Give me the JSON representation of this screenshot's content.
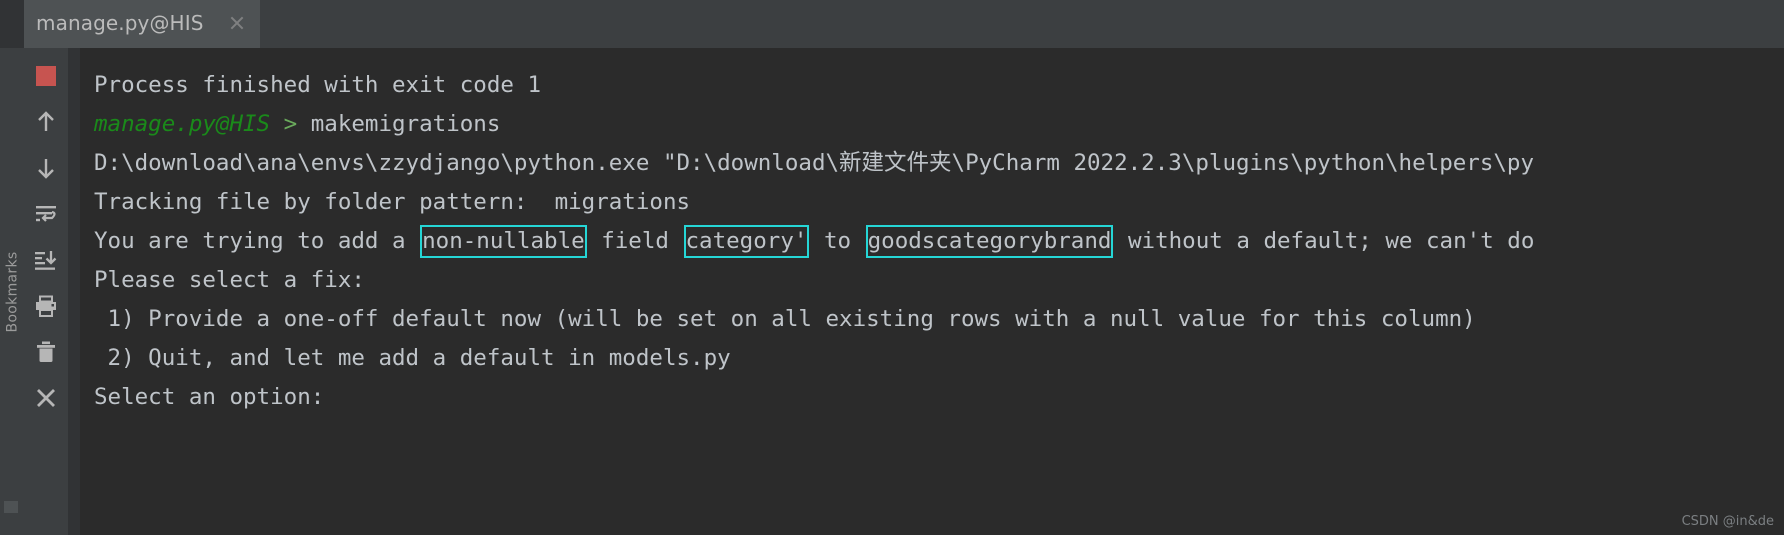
{
  "window": {
    "background_color": "#2b2b2b",
    "chrome_color": "#3c3f41"
  },
  "tab_bar": {
    "tabs": [
      {
        "label": "manage.py@HIS",
        "active": true,
        "close_icon": "close-icon"
      }
    ]
  },
  "left_strip": {
    "label": "Bookmarks"
  },
  "run_toolbar": {
    "buttons": [
      {
        "name": "stop-button",
        "icon": "stop-square-icon",
        "tooltip": "Stop",
        "color": "#c75450"
      },
      {
        "name": "up-button",
        "icon": "arrow-up-icon",
        "tooltip": "Previous Occurrence"
      },
      {
        "name": "down-button",
        "icon": "arrow-down-icon",
        "tooltip": "Next Occurrence"
      },
      {
        "name": "soft-wrap-button",
        "icon": "soft-wrap-icon",
        "tooltip": "Soft-Wrap"
      },
      {
        "name": "scroll-to-end-button",
        "icon": "scroll-to-end-icon",
        "tooltip": "Scroll to End"
      },
      {
        "name": "print-button",
        "icon": "printer-icon",
        "tooltip": "Print"
      },
      {
        "name": "clear-all-button",
        "icon": "trash-icon",
        "tooltip": "Clear All"
      },
      {
        "name": "close-button",
        "icon": "close-icon",
        "tooltip": "Close"
      }
    ]
  },
  "console": {
    "accent_box_color": "#25d6d6",
    "lines": [
      {
        "id": "process-finished",
        "segments": [
          {
            "text": "Process finished with exit code 1",
            "style": "plain"
          }
        ]
      },
      {
        "id": "command-line",
        "segments": [
          {
            "text": "manage.py@HIS",
            "style": "cmd-head"
          },
          {
            "text": " > ",
            "style": "arrow"
          },
          {
            "text": "makemigrations",
            "style": "plain"
          }
        ]
      },
      {
        "id": "interpreter-path",
        "segments": [
          {
            "text": "D:\\download\\ana\\envs\\zzydjango\\python.exe \"D:\\download\\新建文件夹\\PyCharm 2022.2.3\\plugins\\python\\helpers\\py",
            "style": "plain"
          }
        ]
      },
      {
        "id": "tracking-file",
        "segments": [
          {
            "text": "Tracking file by folder pattern:  migrations",
            "style": "plain"
          }
        ]
      },
      {
        "id": "non-nullable-warning",
        "segments": [
          {
            "text": "You are trying to add a ",
            "style": "plain"
          },
          {
            "text": "non-nullable",
            "style": "boxed"
          },
          {
            "text": " field ",
            "style": "plain"
          },
          {
            "text": "category'",
            "style": "boxed"
          },
          {
            "text": " to ",
            "style": "plain"
          },
          {
            "text": "goodscategorybrand",
            "style": "boxed"
          },
          {
            "text": " without a default; we can't do",
            "style": "plain"
          }
        ]
      },
      {
        "id": "please-select-fix",
        "segments": [
          {
            "text": "Please select a fix:",
            "style": "plain"
          }
        ]
      },
      {
        "id": "option-1",
        "segments": [
          {
            "text": " 1) Provide a one-off default now (will be set on all existing rows with a null value for this column)",
            "style": "plain"
          }
        ]
      },
      {
        "id": "option-2",
        "segments": [
          {
            "text": " 2) Quit, and let me add a default in models.py",
            "style": "plain"
          }
        ]
      },
      {
        "id": "select-an-option",
        "segments": [
          {
            "text": "Select an option:",
            "style": "plain"
          }
        ]
      }
    ]
  },
  "watermark": {
    "text": "CSDN @in&de"
  }
}
